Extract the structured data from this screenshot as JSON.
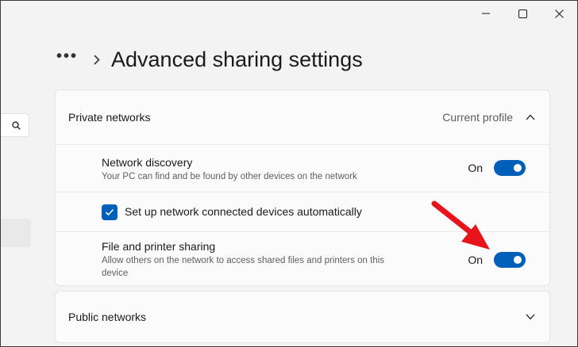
{
  "window": {
    "controls": [
      "minimize-icon",
      "maximize-icon",
      "close-icon"
    ]
  },
  "nav": {
    "search_icon": "search-icon"
  },
  "header": {
    "more": "•••",
    "title": "Advanced sharing settings"
  },
  "private_networks": {
    "label": "Private networks",
    "profile_label": "Current profile",
    "expanded": true,
    "settings": {
      "network_discovery": {
        "title": "Network discovery",
        "description": "Your PC can find and be found by other devices on the network",
        "state": "On",
        "on": true
      },
      "auto_setup": {
        "label": "Set up network connected devices automatically",
        "checked": true
      },
      "file_printer_sharing": {
        "title": "File and printer sharing",
        "description": "Allow others on the network to access shared files and printers on this device",
        "state": "On",
        "on": true
      }
    }
  },
  "public_networks": {
    "label": "Public networks",
    "expanded": false
  },
  "colors": {
    "accent": "#005fb8",
    "annotation_arrow": "#e8141b",
    "background": "#f3f3f3",
    "card": "#fbfbfb"
  }
}
